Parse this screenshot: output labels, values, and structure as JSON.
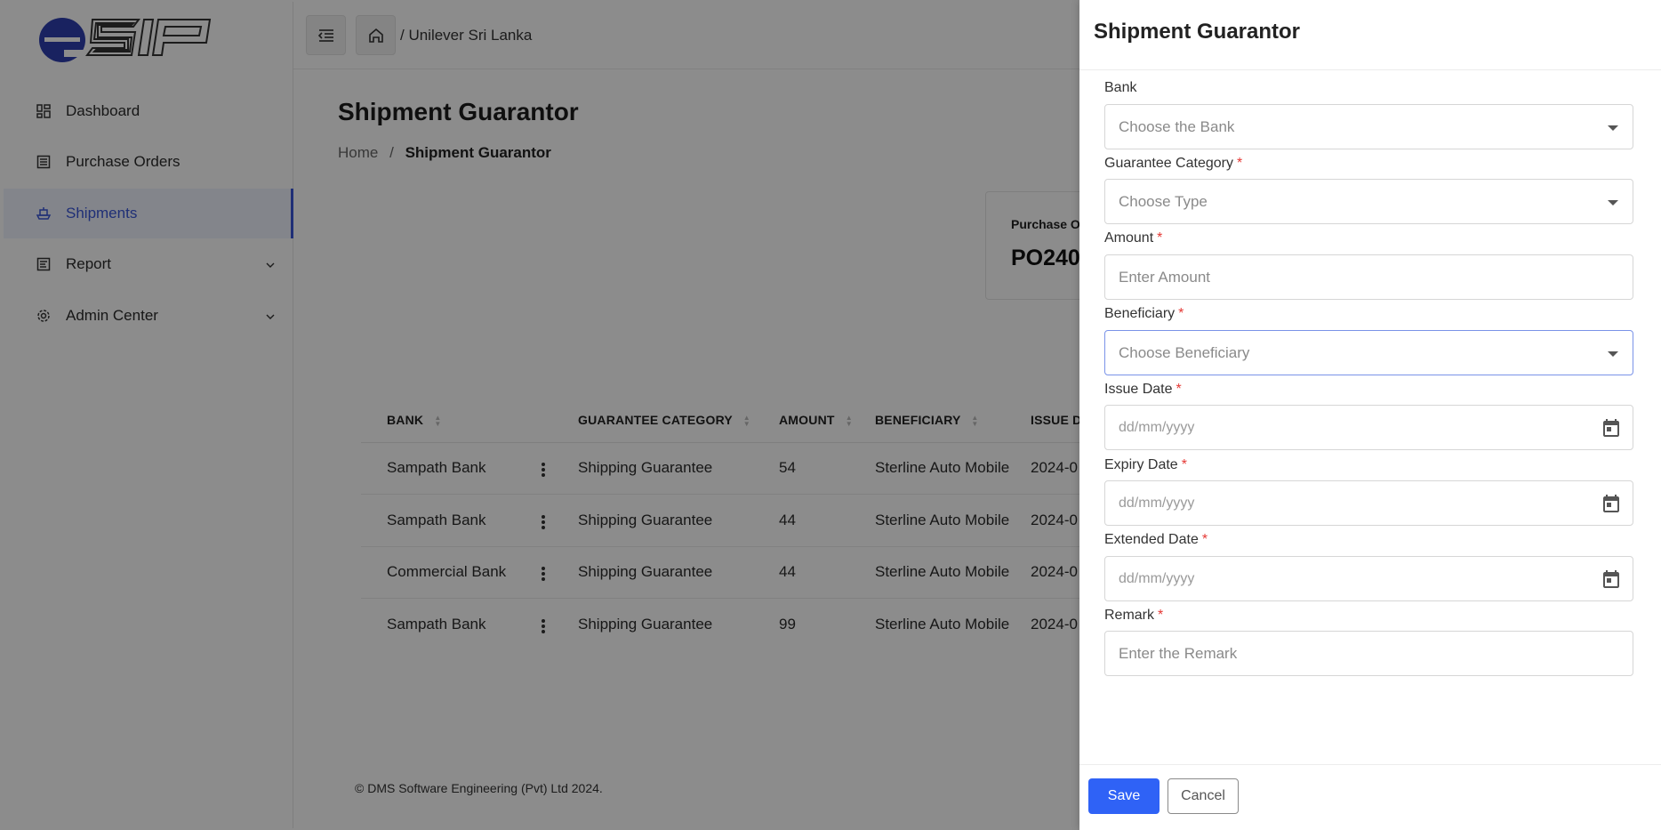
{
  "app": {
    "logo_text": "eSIP"
  },
  "topbar": {
    "breadcrumb": "/ Unilever Sri Lanka"
  },
  "sidebar": {
    "items": [
      {
        "label": "Dashboard",
        "icon": "dashboard-icon"
      },
      {
        "label": "Purchase Orders",
        "icon": "list-icon"
      },
      {
        "label": "Shipments",
        "icon": "ship-icon",
        "active": true
      },
      {
        "label": "Report",
        "icon": "report-icon",
        "expandable": true
      },
      {
        "label": "Admin Center",
        "icon": "gear-icon",
        "expandable": true
      }
    ]
  },
  "main": {
    "title": "Shipment Guarantor",
    "breadcrumb": {
      "home": "Home",
      "separator": "/",
      "current": "Shipment Guarantor"
    },
    "po_card": {
      "label": "Purchase O",
      "value": "PO240"
    }
  },
  "table": {
    "headers": {
      "bank": "BANK",
      "category": "GUARANTEE CATEGORY",
      "amount": "AMOUNT",
      "beneficiary": "BENEFICIARY",
      "issue": "ISSUE D"
    },
    "rows": [
      {
        "bank": "Sampath Bank",
        "category": "Shipping Guarantee",
        "amount": "54",
        "beneficiary": "Sterline Auto Mobile",
        "issue": "2024-0"
      },
      {
        "bank": "Sampath Bank",
        "category": "Shipping Guarantee",
        "amount": "44",
        "beneficiary": "Sterline Auto Mobile",
        "issue": "2024-0"
      },
      {
        "bank": "Commercial Bank",
        "category": "Shipping Guarantee",
        "amount": "44",
        "beneficiary": "Sterline Auto Mobile",
        "issue": "2024-0"
      },
      {
        "bank": "Sampath Bank",
        "category": "Shipping Guarantee",
        "amount": "99",
        "beneficiary": "Sterline Auto Mobile",
        "issue": "2024-0"
      }
    ]
  },
  "footer": {
    "text": "© DMS Software Engineering (Pvt) Ltd 2024."
  },
  "drawer": {
    "title": "Shipment Guarantor",
    "fields": {
      "bank": {
        "label": "Bank",
        "placeholder": "Choose the Bank"
      },
      "category": {
        "label": "Guarantee Category",
        "placeholder": "Choose Type"
      },
      "amount": {
        "label": "Amount",
        "placeholder": "Enter Amount"
      },
      "beneficiary": {
        "label": "Beneficiary",
        "placeholder": "Choose Beneficiary"
      },
      "issue_date": {
        "label": "Issue Date",
        "placeholder": "dd/mm/yyyy"
      },
      "expiry_date": {
        "label": "Expiry Date",
        "placeholder": "dd/mm/yyyy"
      },
      "extended_date": {
        "label": "Extended Date",
        "placeholder": "dd/mm/yyyy"
      },
      "remark": {
        "label": "Remark",
        "placeholder": "Enter the Remark"
      }
    },
    "required_mark": "*",
    "save_label": "Save",
    "cancel_label": "Cancel"
  },
  "colors": {
    "accent": "#2f62f6",
    "active_nav": "#3a57d8",
    "required": "#e53935"
  }
}
